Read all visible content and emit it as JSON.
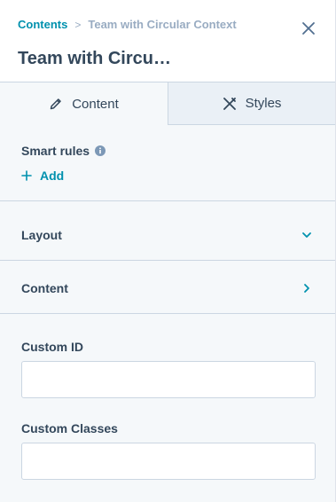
{
  "header": {
    "breadcrumb_root": "Contents",
    "breadcrumb_separator": ">",
    "breadcrumb_current": "Team with Circular Context",
    "title": "Team with Circu…",
    "close_icon": "close-icon"
  },
  "tabs": [
    {
      "label": "Content",
      "icon": "pencil-icon",
      "active": true
    },
    {
      "label": "Styles",
      "icon": "brush-icon",
      "active": false
    }
  ],
  "smart_rules": {
    "label": "Smart rules",
    "info_icon": "info-icon",
    "add_label": "Add"
  },
  "sections": [
    {
      "label": "Layout",
      "icon": "chevron-down-icon",
      "expanded": true
    },
    {
      "label": "Content",
      "icon": "chevron-right-icon",
      "expanded": false
    }
  ],
  "fields": {
    "custom_id": {
      "label": "Custom ID",
      "value": "",
      "placeholder": ""
    },
    "custom_classes": {
      "label": "Custom Classes",
      "value": "",
      "placeholder": ""
    }
  },
  "colors": {
    "accent": "#0091ae",
    "text": "#33475b",
    "muted": "#99acc2",
    "border": "#cbd6e2",
    "panel_bg": "#f5f8fa",
    "inactive_tab_bg": "#eaf0f6"
  }
}
